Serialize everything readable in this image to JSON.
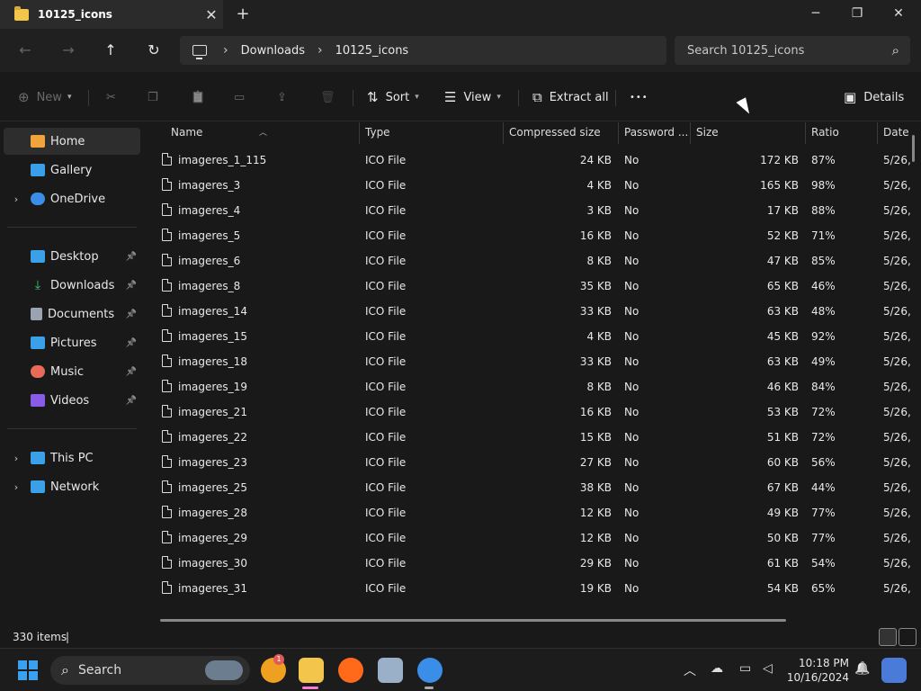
{
  "window": {
    "tab_title": "10125_icons",
    "tab_close": "✕",
    "new_tab": "+",
    "minimize": "─",
    "maximize": "❐",
    "close": "✕"
  },
  "nav": {
    "back": "←",
    "forward": "→",
    "up": "↑",
    "refresh": "↻",
    "breadcrumb": [
      "Downloads",
      "10125_icons"
    ],
    "separator": "›",
    "search_placeholder": "Search 10125_icons",
    "search_icon": "⌕"
  },
  "commands": {
    "new": "New",
    "cut_icon": "✂",
    "copy_icon": "❐",
    "paste_icon": "📋",
    "rename_icon": "▭",
    "share_icon": "⇪",
    "delete_icon": "🗑",
    "sort": "Sort",
    "view": "View",
    "extract_all": "Extract all",
    "more": "•••",
    "details": "Details"
  },
  "sidebar": {
    "items": [
      {
        "label": "Home",
        "color": "#f0a33a",
        "selected": true
      },
      {
        "label": "Gallery",
        "color": "#3a9ee8"
      },
      {
        "label": "OneDrive",
        "color": "#3a8ee8",
        "expandable": true
      },
      {
        "label": "Desktop",
        "color": "#3aa0e8",
        "pinned": true
      },
      {
        "label": "Downloads",
        "color": "#3ec96f",
        "pinned": true
      },
      {
        "label": "Documents",
        "color": "#9aa3b0",
        "pinned": true
      },
      {
        "label": "Pictures",
        "color": "#3aa0e8",
        "pinned": true
      },
      {
        "label": "Music",
        "color": "#e86b5a",
        "pinned": true
      },
      {
        "label": "Videos",
        "color": "#8a5ae8",
        "pinned": true
      },
      {
        "label": "This PC",
        "color": "#3aa0e8",
        "expandable": true
      },
      {
        "label": "Network",
        "color": "#3aa0e8",
        "expandable": true
      }
    ],
    "pin_glyph": "📌",
    "chevron": "›"
  },
  "columns": {
    "name": "Name",
    "type": "Type",
    "compressed": "Compressed size",
    "password": "Password ...",
    "size": "Size",
    "ratio": "Ratio",
    "date": "Date"
  },
  "files": [
    {
      "name": "imageres_1_115",
      "type": "ICO File",
      "compressed": "24 KB",
      "password": "No",
      "size": "172 KB",
      "ratio": "87%",
      "date": "5/26,"
    },
    {
      "name": "imageres_3",
      "type": "ICO File",
      "compressed": "4 KB",
      "password": "No",
      "size": "165 KB",
      "ratio": "98%",
      "date": "5/26,"
    },
    {
      "name": "imageres_4",
      "type": "ICO File",
      "compressed": "3 KB",
      "password": "No",
      "size": "17 KB",
      "ratio": "88%",
      "date": "5/26,"
    },
    {
      "name": "imageres_5",
      "type": "ICO File",
      "compressed": "16 KB",
      "password": "No",
      "size": "52 KB",
      "ratio": "71%",
      "date": "5/26,"
    },
    {
      "name": "imageres_6",
      "type": "ICO File",
      "compressed": "8 KB",
      "password": "No",
      "size": "47 KB",
      "ratio": "85%",
      "date": "5/26,"
    },
    {
      "name": "imageres_8",
      "type": "ICO File",
      "compressed": "35 KB",
      "password": "No",
      "size": "65 KB",
      "ratio": "46%",
      "date": "5/26,"
    },
    {
      "name": "imageres_14",
      "type": "ICO File",
      "compressed": "33 KB",
      "password": "No",
      "size": "63 KB",
      "ratio": "48%",
      "date": "5/26,"
    },
    {
      "name": "imageres_15",
      "type": "ICO File",
      "compressed": "4 KB",
      "password": "No",
      "size": "45 KB",
      "ratio": "92%",
      "date": "5/26,"
    },
    {
      "name": "imageres_18",
      "type": "ICO File",
      "compressed": "33 KB",
      "password": "No",
      "size": "63 KB",
      "ratio": "49%",
      "date": "5/26,"
    },
    {
      "name": "imageres_19",
      "type": "ICO File",
      "compressed": "8 KB",
      "password": "No",
      "size": "46 KB",
      "ratio": "84%",
      "date": "5/26,"
    },
    {
      "name": "imageres_21",
      "type": "ICO File",
      "compressed": "16 KB",
      "password": "No",
      "size": "53 KB",
      "ratio": "72%",
      "date": "5/26,"
    },
    {
      "name": "imageres_22",
      "type": "ICO File",
      "compressed": "15 KB",
      "password": "No",
      "size": "51 KB",
      "ratio": "72%",
      "date": "5/26,"
    },
    {
      "name": "imageres_23",
      "type": "ICO File",
      "compressed": "27 KB",
      "password": "No",
      "size": "60 KB",
      "ratio": "56%",
      "date": "5/26,"
    },
    {
      "name": "imageres_25",
      "type": "ICO File",
      "compressed": "38 KB",
      "password": "No",
      "size": "67 KB",
      "ratio": "44%",
      "date": "5/26,"
    },
    {
      "name": "imageres_28",
      "type": "ICO File",
      "compressed": "12 KB",
      "password": "No",
      "size": "49 KB",
      "ratio": "77%",
      "date": "5/26,"
    },
    {
      "name": "imageres_29",
      "type": "ICO File",
      "compressed": "12 KB",
      "password": "No",
      "size": "50 KB",
      "ratio": "77%",
      "date": "5/26,"
    },
    {
      "name": "imageres_30",
      "type": "ICO File",
      "compressed": "29 KB",
      "password": "No",
      "size": "61 KB",
      "ratio": "54%",
      "date": "5/26,"
    },
    {
      "name": "imageres_31",
      "type": "ICO File",
      "compressed": "19 KB",
      "password": "No",
      "size": "54 KB",
      "ratio": "65%",
      "date": "5/26,"
    }
  ],
  "status": {
    "item_count": "330 items",
    "cursor": "|"
  },
  "taskbar": {
    "search_placeholder": "Search",
    "badge": "1",
    "time": "10:18 PM",
    "date": "10/16/2024",
    "tray_chevron": "︿",
    "tray_bell": "🔔",
    "apps": [
      {
        "name": "swirl-app-icon",
        "color": "#f0a020"
      },
      {
        "name": "file-explorer-icon",
        "color": "#f3c64b"
      },
      {
        "name": "firefox-icon",
        "color": "#ff6a1a"
      },
      {
        "name": "archive-app-icon",
        "color": "#9ab0c8"
      },
      {
        "name": "chrome-icon",
        "color": "#3a8ee8"
      }
    ]
  }
}
